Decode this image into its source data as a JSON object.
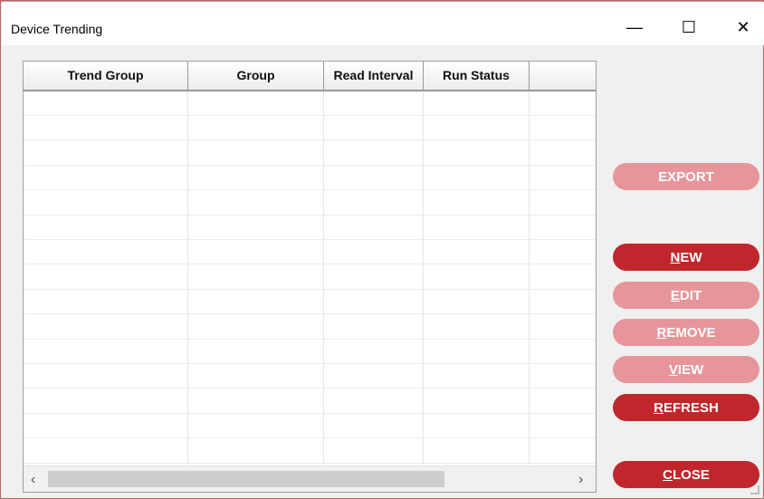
{
  "window": {
    "title": "Device Trending",
    "minimize_glyph": "—",
    "maximize_glyph": "☐",
    "close_glyph": "✕"
  },
  "grid": {
    "columns": [
      "Trend Group",
      "Group",
      "Read Interval",
      "Run Status",
      ""
    ],
    "rows": [],
    "scroll_left": "‹",
    "scroll_right": "›"
  },
  "buttons": {
    "export": {
      "label": "EXPORT",
      "enabled": false
    },
    "new": {
      "accel": "N",
      "rest": "EW",
      "enabled": true
    },
    "edit": {
      "accel": "E",
      "rest": "DIT",
      "enabled": false
    },
    "remove": {
      "accel": "R",
      "rest": "EMOVE",
      "enabled": false
    },
    "view": {
      "accel": "V",
      "rest": "IEW",
      "enabled": false
    },
    "refresh": {
      "accel": "R",
      "rest": "EFRESH",
      "enabled": true
    },
    "close": {
      "accel": "C",
      "rest": "LOSE",
      "enabled": true
    }
  },
  "colors": {
    "button_active": "#c0272d",
    "button_disabled": "#e6969b"
  }
}
